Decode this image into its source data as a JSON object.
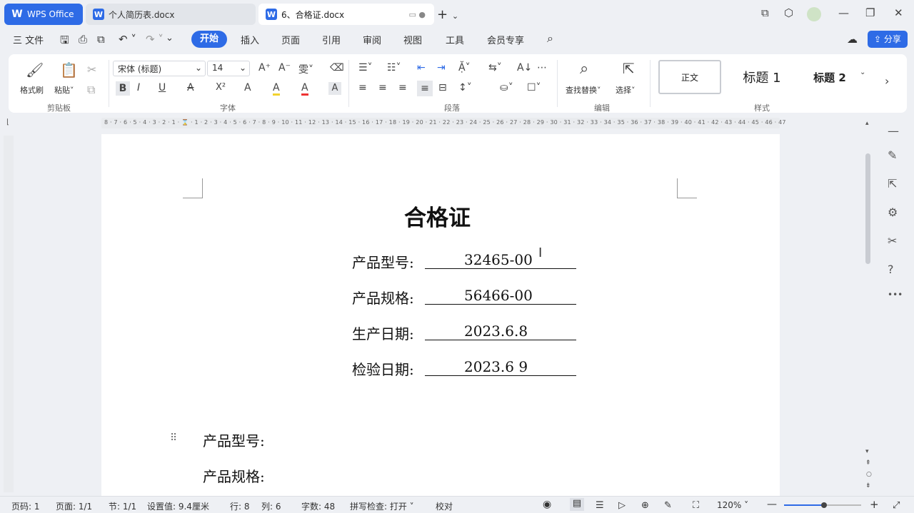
{
  "titlebar": {
    "app_tab": "WPS Office",
    "tabs": [
      {
        "label": "个人简历表.docx"
      },
      {
        "label": "6、合格证.docx"
      }
    ],
    "new_tab": "+",
    "new_tab_menu": "⌄"
  },
  "window": {
    "minimize": "—",
    "restore": "❐",
    "close": "✕"
  },
  "menu": {
    "file": "三 文件",
    "items": [
      "开始",
      "插入",
      "页面",
      "引用",
      "审阅",
      "视图",
      "工具",
      "会员专享"
    ],
    "active": "开始",
    "share": "分享"
  },
  "ribbon": {
    "clipboard": {
      "format_painter": "格式刷",
      "paste": "粘贴",
      "group": "剪贴板"
    },
    "font": {
      "name": "宋体 (标题)",
      "size": "14",
      "group": "字体",
      "bold": "B",
      "italic": "I",
      "underline": "U",
      "strike": "A",
      "superscript": "X²",
      "text_effect": "A",
      "highlight": "A",
      "font_color": "A",
      "char_shading": "A"
    },
    "paragraph": {
      "group": "段落"
    },
    "editing": {
      "find_replace": "查找替换",
      "select": "选择",
      "group": "编辑"
    },
    "styles": {
      "group": "样式",
      "normal": "正文",
      "heading1": "标题 1",
      "heading2": "标题 2"
    }
  },
  "ruler": {
    "ticks": "8 · 7 · 6 · 5 · 4 · 3 · 2 · 1 · ⌛ · 1 · 2 · 3 · 4 · 5 · 6 · 7 · 8 · 9 · 10 · 11 · 12 · 13 · 14 · 15 · 16 · 17 · 18 · 19 · 20 · 21 · 22 · 23 · 24 · 25 · 26 · 27 · 28 · 29 · 30 · 31 · 32 · 33 · 34 · 35 · 36 · 37 · 38 · 39 · 40 · 41 · 42 · 43 · 44 · 45 · 46 · 47"
  },
  "document": {
    "title": "合格证",
    "fields": [
      {
        "label": "产品型号:",
        "value": "32465-00"
      },
      {
        "label": "产品规格:",
        "value": "56466-00"
      },
      {
        "label": "生产日期:",
        "value": "2023.6.8"
      },
      {
        "label": "检验日期:",
        "value": "2023.6 9"
      }
    ],
    "lower_fields": [
      "产品型号:",
      "产品规格:"
    ]
  },
  "status": {
    "page_num": "页码: 1",
    "page": "页面: 1/1",
    "section": "节: 1/1",
    "setting": "设置值: 9.4厘米",
    "row": "行: 8",
    "col": "列: 6",
    "words": "字数: 48",
    "spellcheck": "拼写检查: 打开",
    "proof": "校对",
    "zoom": "120%",
    "zoom_fraction": 0.52
  },
  "colors": {
    "accent": "#2e6be6",
    "bg": "#eef0f4"
  }
}
